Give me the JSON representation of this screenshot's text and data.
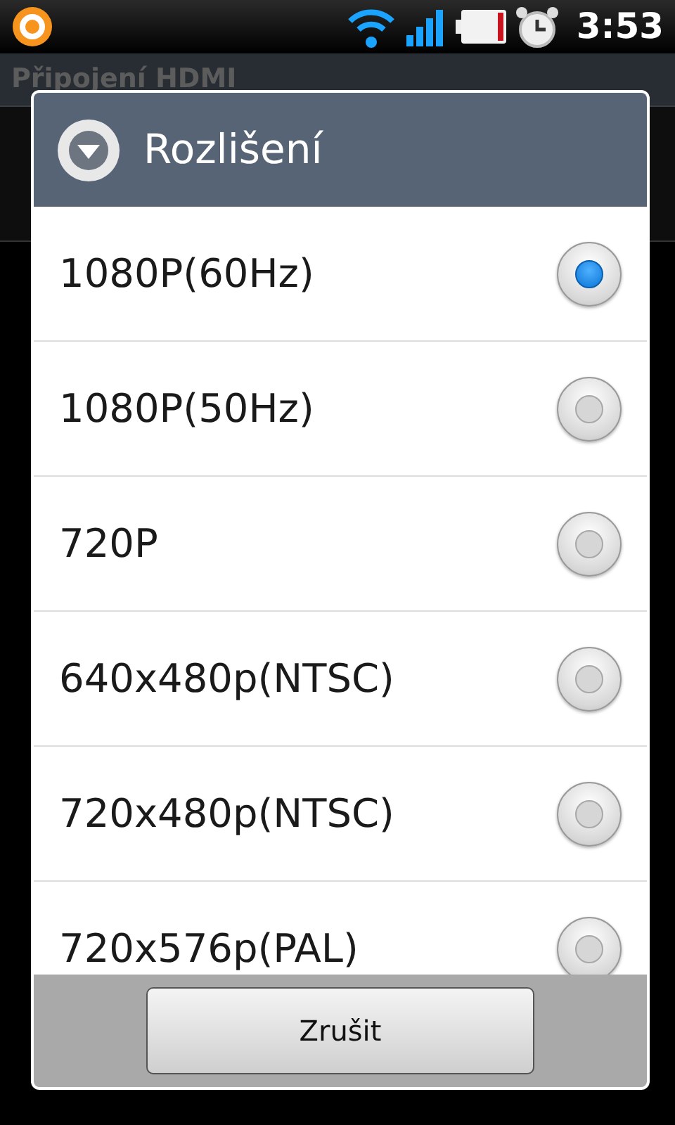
{
  "status_bar": {
    "time": "3:53"
  },
  "screen": {
    "title": "Připojení HDMI"
  },
  "dialog": {
    "title": "Rozlišení",
    "options": [
      {
        "label": "1080P(60Hz)",
        "selected": true
      },
      {
        "label": "1080P(50Hz)",
        "selected": false
      },
      {
        "label": "720P",
        "selected": false
      },
      {
        "label": "640x480p(NTSC)",
        "selected": false
      },
      {
        "label": "720x480p(NTSC)",
        "selected": false
      },
      {
        "label": "720x576p(PAL)",
        "selected": false
      }
    ],
    "buttons": [
      "Zrušit"
    ]
  }
}
